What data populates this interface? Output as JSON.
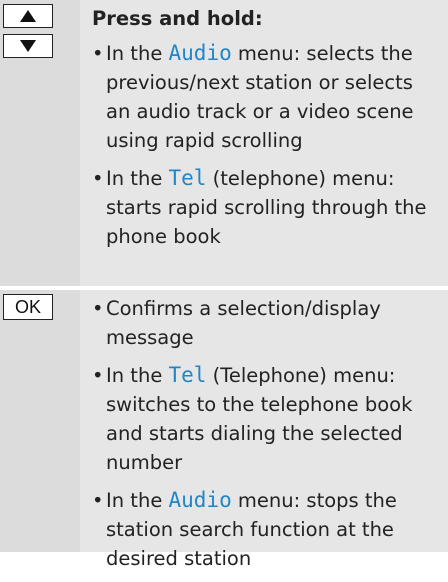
{
  "row1": {
    "heading": "Press and hold:",
    "bullets": [
      {
        "pre": "In the ",
        "menu": "Audio",
        "post": " menu: selects the previous/next station or selects an audio track or a video scene using rapid scrolling"
      },
      {
        "pre": "In the ",
        "menu": "Tel",
        "post": " (telephone) menu: starts rapid scrolling through the phone book"
      }
    ]
  },
  "row2": {
    "key_label": "OK",
    "bullets": [
      {
        "pre": "Confirms a selection/display message",
        "menu": "",
        "post": ""
      },
      {
        "pre": "In the ",
        "menu": "Tel",
        "post": " (Telephone) menu: switches to the telephone book and starts dialing the selected number"
      },
      {
        "pre": "In the ",
        "menu": "Audio",
        "post": " menu: stops the station search function at the desired station"
      }
    ]
  },
  "colors": {
    "menu_word": "#1f86c8",
    "key_column": "#dcdcdc",
    "content_background": "#e6e6e6"
  }
}
